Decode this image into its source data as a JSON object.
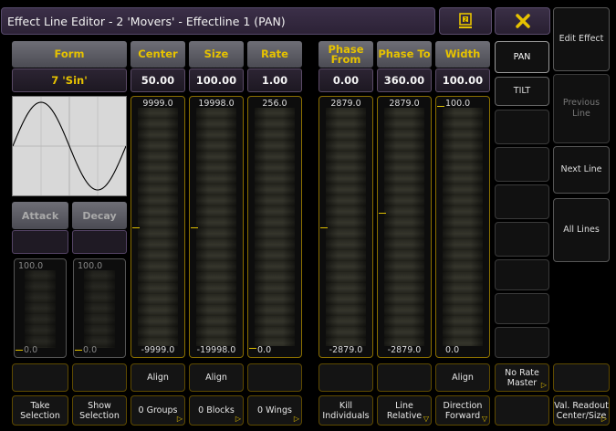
{
  "title": "Effect Line Editor - 2 'Movers' - Effectline 1 (PAN)",
  "icons": {
    "sheet": "sheet-icon",
    "close": "close-icon"
  },
  "colors": {
    "accent": "#e6c200",
    "border": "#8a6f00",
    "title_bg": "#3b2f48"
  },
  "columns": {
    "form": {
      "label": "Form",
      "value": "7 'Sin'"
    },
    "center": {
      "label": "Center",
      "value": "50.00",
      "max": "9999.0",
      "min": "-9999.0",
      "level": 0.5
    },
    "size": {
      "label": "Size",
      "value": "100.00",
      "max": "19998.0",
      "min": "-19998.0",
      "level": 0.5
    },
    "rate": {
      "label": "Rate",
      "value": "1.00",
      "max": "256.0",
      "min": "0.0",
      "level": 0.0
    },
    "phase_from": {
      "label": "Phase From",
      "value": "0.00",
      "max": "2879.0",
      "min": "-2879.0",
      "level": 0.5
    },
    "phase_to": {
      "label": "Phase To",
      "value": "360.00",
      "max": "2879.0",
      "min": "-2879.0",
      "level": 0.56
    },
    "width": {
      "label": "Width",
      "value": "100.00",
      "max": "100.0",
      "min": "0.0",
      "level": 1.0
    }
  },
  "attack": {
    "label": "Attack",
    "max": "100.0",
    "min": "0.0"
  },
  "decay": {
    "label": "Decay",
    "max": "100.0",
    "min": "0.0"
  },
  "attributes": [
    "PAN",
    "TILT"
  ],
  "side_menu": {
    "edit_effect": "Edit Effect",
    "previous_line": "Previous Line",
    "next_line": "Next Line",
    "all_lines": "All Lines"
  },
  "row1": {
    "center_align": "Align",
    "size_align": "Align",
    "width_align": "Align",
    "no_rate_master": "No Rate Master"
  },
  "row2": {
    "take_selection": "Take Selection",
    "show_selection": "Show Selection",
    "groups": "0 Groups",
    "blocks": "0 Blocks",
    "wings": "0 Wings",
    "kill_individuals": "Kill Individuals",
    "line_relative": "Line Relative",
    "direction_forward": "Direction Forward",
    "val_readout": "Val. Readout Center/Size"
  }
}
